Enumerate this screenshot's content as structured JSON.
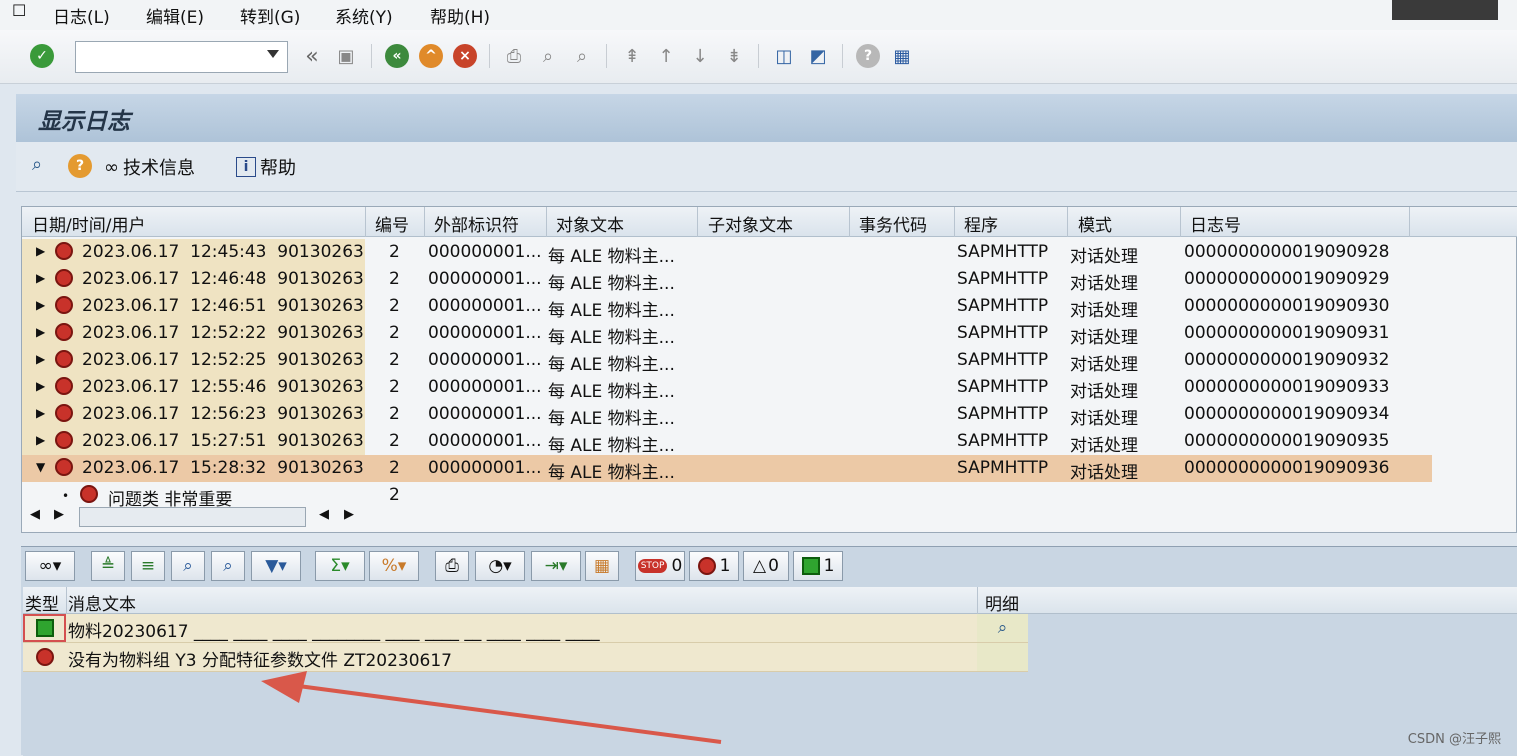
{
  "menu": {
    "items": [
      "日志(L)",
      "编辑(E)",
      "转到(G)",
      "系统(Y)",
      "帮助(H)"
    ]
  },
  "screen": {
    "title": "显示日志"
  },
  "app_toolbar": {
    "tech_info": "技术信息",
    "help": "帮助"
  },
  "log_table": {
    "headers": [
      "日期/时间/用户",
      "编号",
      "外部标识符",
      "对象文本",
      "子对象文本",
      "事务代码",
      "程序",
      "模式",
      "日志号"
    ],
    "rows": [
      {
        "date": "2023.06.17",
        "time": "12:45:43",
        "user": "90130263",
        "num": "2",
        "ext": "000000001...",
        "obj": "每 ALE 物料主...",
        "prog": "SAPMHTTP",
        "mode": "对话处理",
        "log": "0000000000019090928"
      },
      {
        "date": "2023.06.17",
        "time": "12:46:48",
        "user": "90130263",
        "num": "2",
        "ext": "000000001...",
        "obj": "每 ALE 物料主...",
        "prog": "SAPMHTTP",
        "mode": "对话处理",
        "log": "0000000000019090929"
      },
      {
        "date": "2023.06.17",
        "time": "12:46:51",
        "user": "90130263",
        "num": "2",
        "ext": "000000001...",
        "obj": "每 ALE 物料主...",
        "prog": "SAPMHTTP",
        "mode": "对话处理",
        "log": "0000000000019090930"
      },
      {
        "date": "2023.06.17",
        "time": "12:52:22",
        "user": "90130263",
        "num": "2",
        "ext": "000000001...",
        "obj": "每 ALE 物料主...",
        "prog": "SAPMHTTP",
        "mode": "对话处理",
        "log": "0000000000019090931"
      },
      {
        "date": "2023.06.17",
        "time": "12:52:25",
        "user": "90130263",
        "num": "2",
        "ext": "000000001...",
        "obj": "每 ALE 物料主...",
        "prog": "SAPMHTTP",
        "mode": "对话处理",
        "log": "0000000000019090932"
      },
      {
        "date": "2023.06.17",
        "time": "12:55:46",
        "user": "90130263",
        "num": "2",
        "ext": "000000001...",
        "obj": "每 ALE 物料主...",
        "prog": "SAPMHTTP",
        "mode": "对话处理",
        "log": "0000000000019090933"
      },
      {
        "date": "2023.06.17",
        "time": "12:56:23",
        "user": "90130263",
        "num": "2",
        "ext": "000000001...",
        "obj": "每 ALE 物料主...",
        "prog": "SAPMHTTP",
        "mode": "对话处理",
        "log": "0000000000019090934"
      },
      {
        "date": "2023.06.17",
        "time": "15:27:51",
        "user": "90130263",
        "num": "2",
        "ext": "000000001...",
        "obj": "每 ALE 物料主...",
        "prog": "SAPMHTTP",
        "mode": "对话处理",
        "log": "0000000000019090935"
      },
      {
        "date": "2023.06.17",
        "time": "15:28:32",
        "user": "90130263",
        "num": "2",
        "ext": "000000001...",
        "obj": "每 ALE 物料主...",
        "prog": "SAPMHTTP",
        "mode": "对话处理",
        "log": "0000000000019090936"
      }
    ],
    "child": {
      "label": "问题类 非常重要",
      "num": "2"
    }
  },
  "counters": {
    "stop": "0",
    "error": "1",
    "warning": "0",
    "success": "1"
  },
  "msg_table": {
    "headers": {
      "type": "类型",
      "text": "消息文本",
      "detail": "明细"
    },
    "rows": [
      {
        "text": "物料20230617 ____ ____ ____ ________ ____ ____ __ ____ ____ ____"
      },
      {
        "text": "没有为物料组 Y3 分配特征参数文件 ZT20230617"
      }
    ]
  },
  "watermark": "CSDN @汪子熙"
}
